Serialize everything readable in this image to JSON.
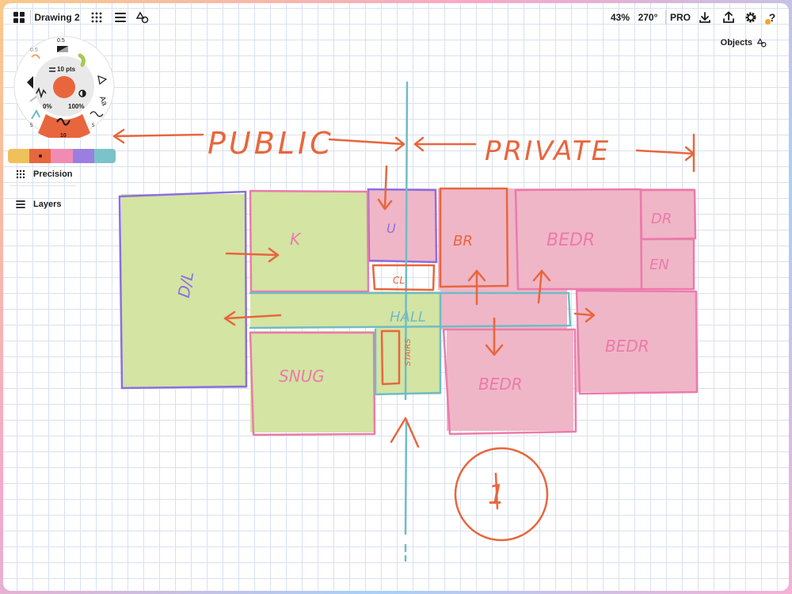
{
  "app": {
    "document_title": "Drawing 2",
    "zoom": "43%",
    "rotation": "270°",
    "pro_label": "PRO",
    "help_label": "?"
  },
  "toolbar_icons": {
    "gallery": "grid-four-squares-icon",
    "grid": "dot-grid-icon",
    "layers": "layers-lines-icon",
    "shapes": "shapes-icon",
    "import": "download-icon",
    "export": "share-upload-icon",
    "settings": "gear-icon"
  },
  "objects_panel": {
    "label": "Objects"
  },
  "tool_wheel": {
    "stroke_size": "10 pts",
    "opacity_min": "0%",
    "opacity_max": "100%",
    "top_value": "0.5",
    "left_value": "0.5",
    "text_tool": "Aa",
    "active_pen_size": "10",
    "small_label_a": "5",
    "small_label_b": "5",
    "active_color": "#e8663d"
  },
  "palette": {
    "colors": [
      "#f0c05a",
      "#e8663d",
      "#f08cb4",
      "#9b7fe0",
      "#79c3c9"
    ],
    "selected_index": 1
  },
  "side_panel": {
    "precision_label": "Precision",
    "layers_label": "Layers"
  },
  "sketch_labels": {
    "public": "PUBLIC",
    "private": "PRIVATE",
    "dining_living": "D/L",
    "kitchen": "K",
    "utility": "U",
    "cloak": "CL",
    "bedroom_small": "BR",
    "bedroom_top": "BEDR",
    "dressing": "DR",
    "ensuite": "EN",
    "hall": "HALL",
    "stairs": "STAIRS",
    "snug": "SNUG",
    "bedroom_mid": "BEDR",
    "bedroom_right": "BEDR",
    "floor_number": "1"
  }
}
